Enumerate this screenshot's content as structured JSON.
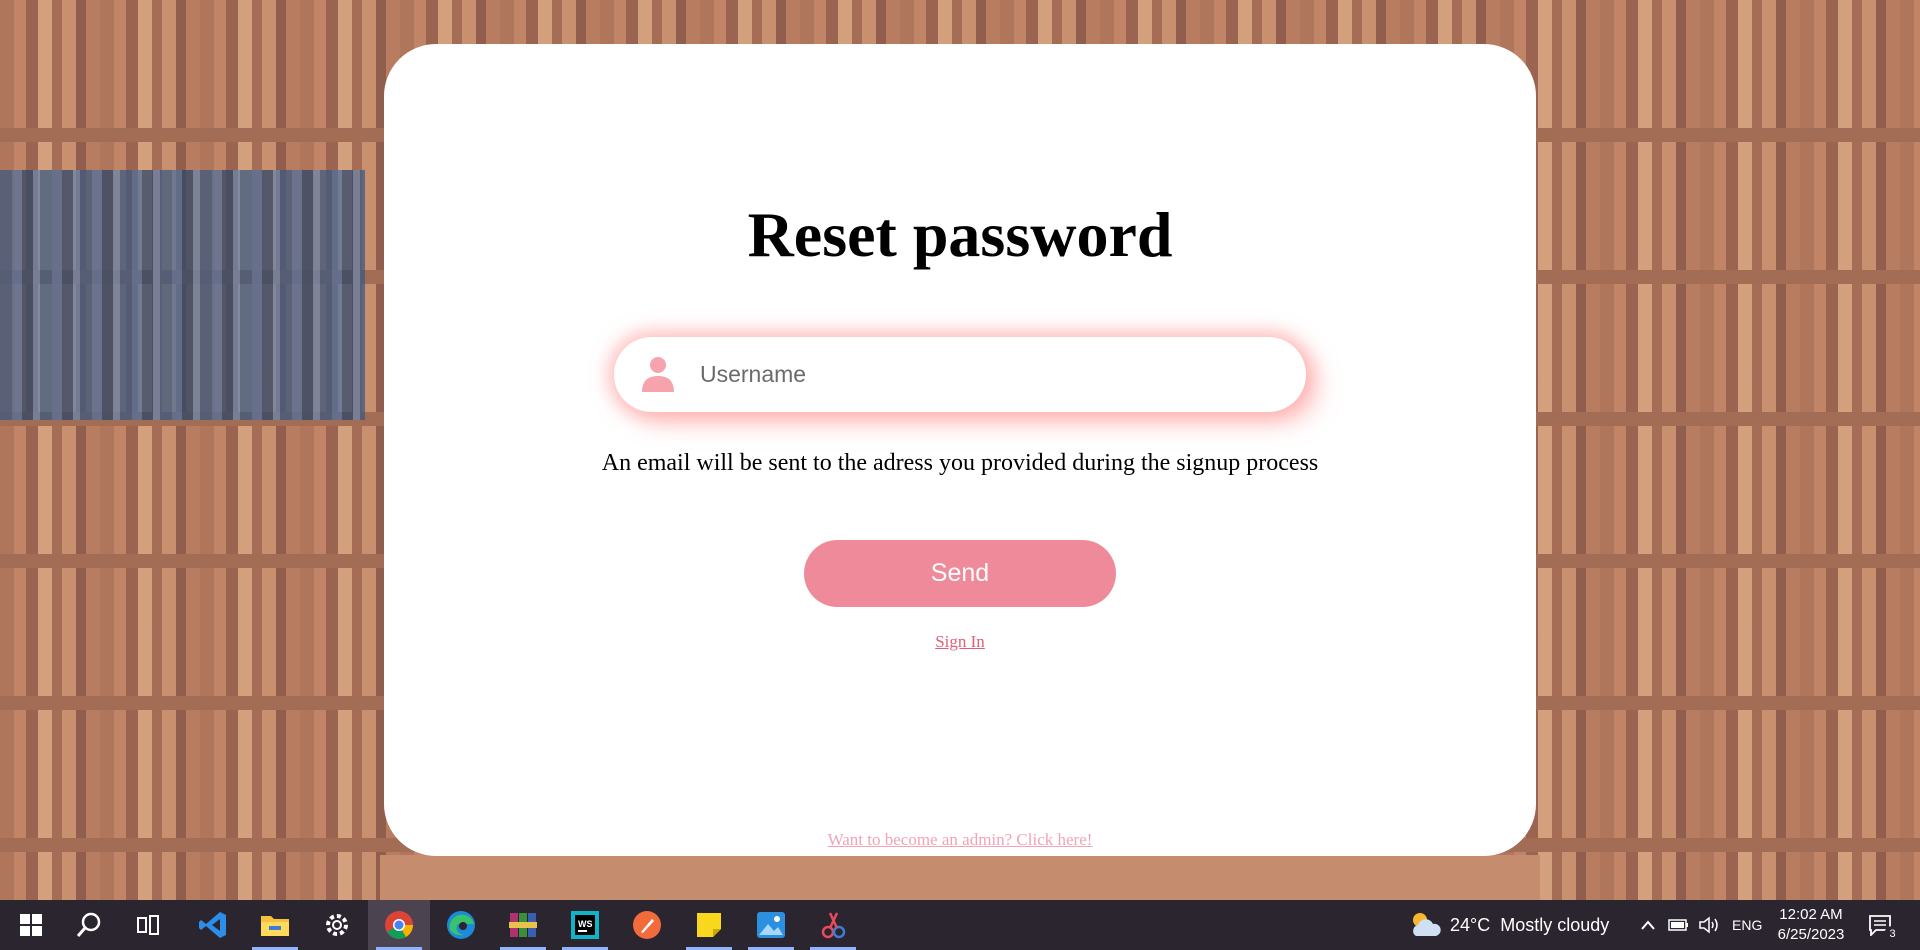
{
  "page": {
    "title": "Reset password",
    "username_placeholder": "Username",
    "info_text": "An email will be sent to the adress you provided during the signup process",
    "send_label": "Send",
    "signin_label": "Sign In",
    "admin_link_label": "Want to become an admin? Click here!"
  },
  "colors": {
    "accent": "#ef8a9a",
    "link": "#e05f77",
    "admin_link": "#f2a3b4",
    "card": "#ffffff",
    "taskbar": "#2b2530"
  },
  "taskbar": {
    "apps": [
      {
        "name": "windows-start-icon"
      },
      {
        "name": "search-icon"
      },
      {
        "name": "task-view-icon"
      },
      {
        "name": "vscode-icon"
      },
      {
        "name": "file-explorer-icon"
      },
      {
        "name": "settings-gear-icon"
      },
      {
        "name": "chrome-icon",
        "active": true
      },
      {
        "name": "edge-icon"
      },
      {
        "name": "winrar-icon"
      },
      {
        "name": "webstorm-icon"
      },
      {
        "name": "postman-icon"
      },
      {
        "name": "sticky-notes-icon"
      },
      {
        "name": "photos-icon"
      },
      {
        "name": "snipping-tool-icon"
      }
    ],
    "weather": {
      "temperature": "24°C",
      "condition": "Mostly cloudy"
    },
    "language": "ENG",
    "time": "12:02 AM",
    "date": "6/25/2023",
    "notification_count": "3"
  }
}
